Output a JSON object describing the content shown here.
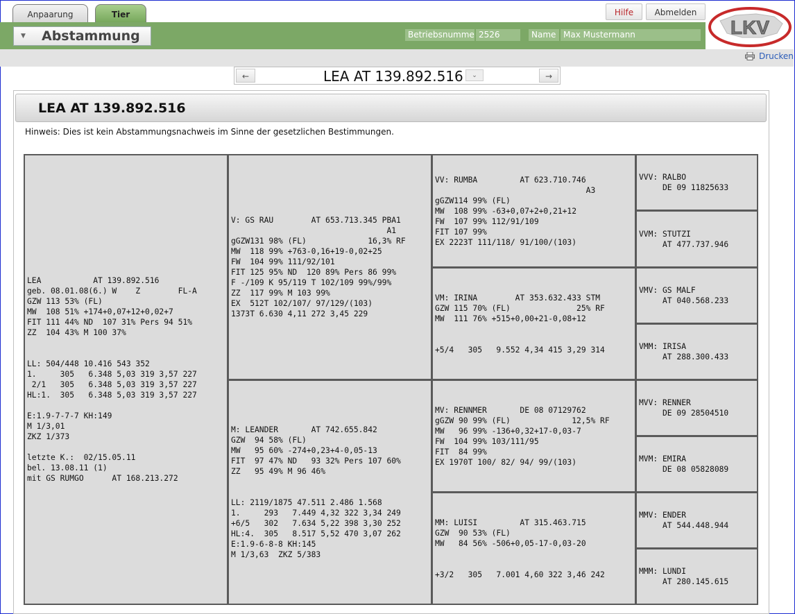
{
  "tabs": [
    "Anpaarung",
    "Tier"
  ],
  "buttons": {
    "hilfe": "Hilfe",
    "abmelden": "Abmelden"
  },
  "header": {
    "title": "Abstammung",
    "betriebsnummer_label": "Betriebsnummer",
    "betriebsnummer_value": "2526",
    "name_label": "Name",
    "name_value": "Max Mustermann"
  },
  "logo": {
    "text": "LKV"
  },
  "toolbar": {
    "print_label": "Drucken"
  },
  "nav": {
    "prev": "←",
    "next": "→",
    "animal": "LEA   AT 139.892.516",
    "dropdown": "⌄"
  },
  "panel": {
    "title": "LEA   AT 139.892.516",
    "hint": "Hinweis: Dies ist kein Abstammungsnachweis im Sinne der gesetzlichen Bestimmungen."
  },
  "pedigree": {
    "animal": "LEA           AT 139.892.516\ngeb. 08.01.08(6.) W    Z        FL-A\nGZW 113 53% (FL)\nMW  108 51% +174+0,07+12+0,02+7\nFIT 111 44% ND  107 31% Pers 94 51%\nZZ  104 43% M 100 37%\n\n\nLL: 504/448 10.416 543 352\n1.     305   6.348 5,03 319 3,57 227\n 2/1   305   6.348 5,03 319 3,57 227\nHL:1.  305   6.348 5,03 319 3,57 227\n\nE:1.9-7-7-7 KH:149\nM 1/3,01\nZKZ 1/373\n\nletzte K.:  02/15.05.11\nbel. 13.08.11 (1)\nmit GS RUMGO      AT 168.213.272",
    "v": "V: GS RAU        AT 653.713.345 PBA1\n                                 A1\ngGZW131 98% (FL)             16,3% RF\nMW  118 99% +763-0,16+19-0,02+25\nFW  104 99% 111/92/101\nFIT 125 95% ND  120 89% Pers 86 99%\nF -/109 K 95/119 T 102/109 99%/99%\nZZ  117 99% M 103 99%\nEX  512T 102/107/ 97/129/(103)\n1373T 6.630 4,11 272 3,45 229",
    "m": "M: LEANDER       AT 742.655.842\nGZW  94 58% (FL)\nMW   95 60% -274+0,23+4-0,05-13\nFIT  97 47% ND   93 32% Pers 107 60%\nZZ   95 49% M 96 46%\n\n\nLL: 2119/1875 47.511 2.486 1.568\n1.     293   7.449 4,32 322 3,34 249\n+6/5   302   7.634 5,22 398 3,30 252\nHL:4.  305   8.517 5,52 470 3,07 262\nE:1.9-6-8-8 KH:145\nM 1/3,63  ZKZ 5/383",
    "vv": "VV: RUMBA         AT 623.710.746\n                                A3\ngGZW114 99% (FL)\nMW  108 99% -63+0,07+2+0,21+12\nFW  107 99% 112/91/109\nFIT 107 99%\nEX 2223T 111/118/ 91/100/(103)",
    "vm": "VM: IRINA        AT 353.632.433 STM\nGZW 115 70% (FL)              25% RF\nMW  111 76% +515+0,00+21-0,08+12\n\n\n+5/4   305   9.552 4,34 415 3,29 314",
    "mv": "MV: RENNMER       DE 08 07129762\ngGZW 90 99% (FL)             12,5% RF\nMW   96 99% -136+0,32+17-0,03-7\nFW  104 99% 103/111/95\nFIT  84 99%\nEX 1970T 100/ 82/ 94/ 99/(103)",
    "mm": "MM: LUISI         AT 315.463.715\nGZW  90 53% (FL)\nMW   84 56% -506+0,05-17-0,03-20\n\n\n+3/2   305   7.001 4,60 322 3,46 242",
    "vvv": "VVV: RALBO\n     DE 09 11825633",
    "vvm": "VVM: STUTZI\n     AT 477.737.946",
    "vmv": "VMV: GS MALF\n     AT 040.568.233",
    "vmm": "VMM: IRISA\n     AT 288.300.433",
    "mvv": "MVV: RENNER\n     DE 09 28504510",
    "mvm": "MVM: EMIRA\n     DE 08 05828089",
    "mmv": "MMV: ENDER\n     AT 544.448.944",
    "mmm": "MMM: LUNDI\n     AT 280.145.615"
  },
  "colors": {
    "green_header": "#7ca866",
    "active_tab": "#8fbf75",
    "cell_bg": "#dcdcdc",
    "grid_lines": "#5a5a5a",
    "link": "#2a5bb8"
  }
}
